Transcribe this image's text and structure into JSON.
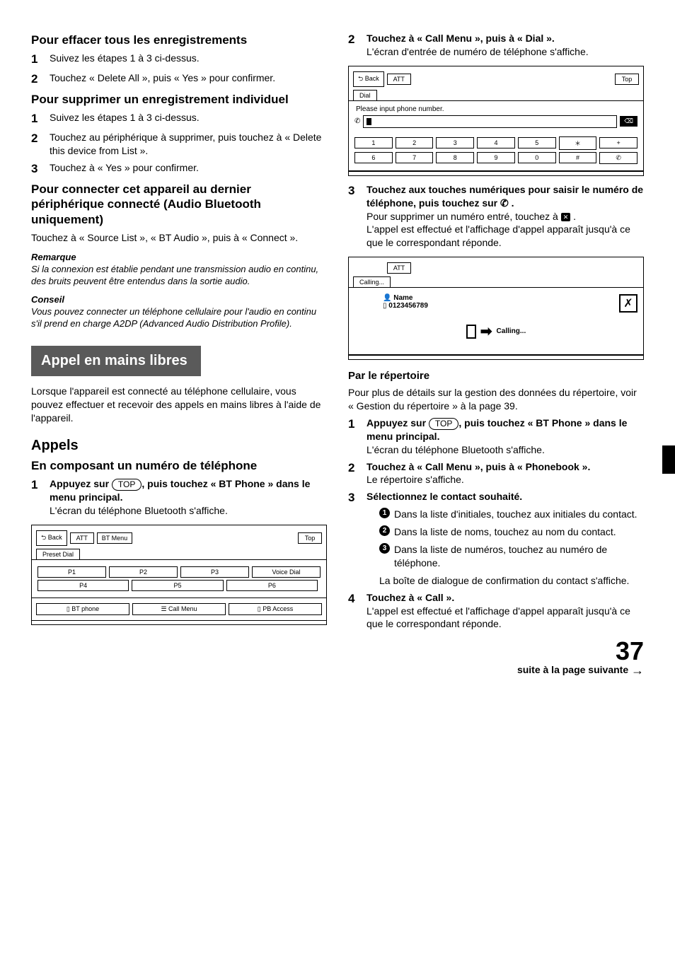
{
  "left": {
    "h_erase": "Pour effacer tous les enregistrements",
    "erase1": "Suivez les étapes 1 à 3 ci-dessus.",
    "erase2": "Touchez « Delete All », puis « Yes » pour confirmer.",
    "h_del1": "Pour supprimer un enregistrement individuel",
    "del1_1": "Suivez les étapes 1 à 3 ci-dessus.",
    "del1_2": "Touchez au périphérique à supprimer, puis touchez à « Delete this device from List ».",
    "del1_3": "Touchez à « Yes » pour confirmer.",
    "h_conn": "Pour connecter cet appareil au dernier périphérique connecté (Audio Bluetooth uniquement)",
    "conn_p": "Touchez à « Source List », « BT Audio », puis à « Connect ».",
    "rem_lbl": "Remarque",
    "rem_txt": "Si la connexion est établie pendant une transmission audio en continu, des bruits peuvent être entendus dans la sortie audio.",
    "con_lbl": "Conseil",
    "con_txt": "Vous pouvez connecter un téléphone cellulaire pour l'audio en continu s'il prend en charge A2DP (Advanced Audio Distribution Profile).",
    "banner": "Appel en mains libres",
    "banner_p": "Lorsque l'appareil est connecté au téléphone cellulaire, vous pouvez effectuer et recevoir des appels en mains libres à l'aide de l'appareil.",
    "h_appels": "Appels",
    "h_compose": "En composant un numéro de téléphone",
    "c1a": "Appuyez sur ",
    "c1b": ", puis touchez « BT Phone » dans le menu principal.",
    "c1c": "L'écran du téléphone Bluetooth s'affiche.",
    "top_btn": "TOP",
    "fig1": {
      "back": "Back",
      "att": "ATT",
      "btmenu": "BT Menu",
      "top": "Top",
      "tab": "Preset Dial",
      "p1": "P1",
      "p2": "P2",
      "p3": "P3",
      "vd": "Voice Dial",
      "p4": "P4",
      "p5": "P5",
      "p6": "P6",
      "bt": "BT phone",
      "cm": "Call Menu",
      "pb": "PB Access"
    }
  },
  "right": {
    "s2": "Touchez à « Call Menu », puis à « Dial ».",
    "s2c": "L'écran d'entrée de numéro de téléphone s'affiche.",
    "fig2": {
      "back": "Back",
      "att": "ATT",
      "top": "Top",
      "tab": "Dial",
      "prompt": "Please input phone number.",
      "keys": [
        "1",
        "2",
        "3",
        "4",
        "5",
        "6",
        "7",
        "8",
        "9",
        "0"
      ],
      "star": "＊",
      "plus": "+",
      "hash": "#"
    },
    "s3a": "Touchez aux touches numériques pour saisir le numéro de téléphone, puis touchez sur ",
    "s3b": " .",
    "s3c1": "Pour supprimer un numéro entré, touchez à",
    "s3c2": ".",
    "s3d": "L'appel est effectué et l'affichage d'appel apparaît jusqu'à ce que le correspondant réponde.",
    "fig3": {
      "att": "ATT",
      "tab": "Calling...",
      "name": "Name",
      "num": "0123456789",
      "status": "Calling..."
    },
    "h_rep": "Par le répertoire",
    "rep_p": "Pour plus de détails sur la gestion des données du répertoire, voir « Gestion du répertoire » à la page 39.",
    "r1a": "Appuyez sur ",
    "r1b": ", puis touchez « BT Phone » dans le menu principal.",
    "r1c": "L'écran du téléphone Bluetooth s'affiche.",
    "r2a": "Touchez à « Call Menu », puis à « Phonebook ».",
    "r2b": "Le répertoire s'affiche.",
    "r3": "Sélectionnez le contact souhaité.",
    "sub1": "Dans la liste d'initiales, touchez aux initiales du contact.",
    "sub2": "Dans la liste de noms, touchez au nom du contact.",
    "sub3": "Dans la liste de numéros, touchez au numéro de téléphone.",
    "sub_end": "La boîte de dialogue de confirmation du contact s'affiche.",
    "r4a": "Touchez à « Call ».",
    "r4b": "L'appel est effectué et l'affichage d'appel apparaît jusqu'à ce que le correspondant réponde.",
    "page": "37",
    "footer": "suite à la page suivante "
  }
}
